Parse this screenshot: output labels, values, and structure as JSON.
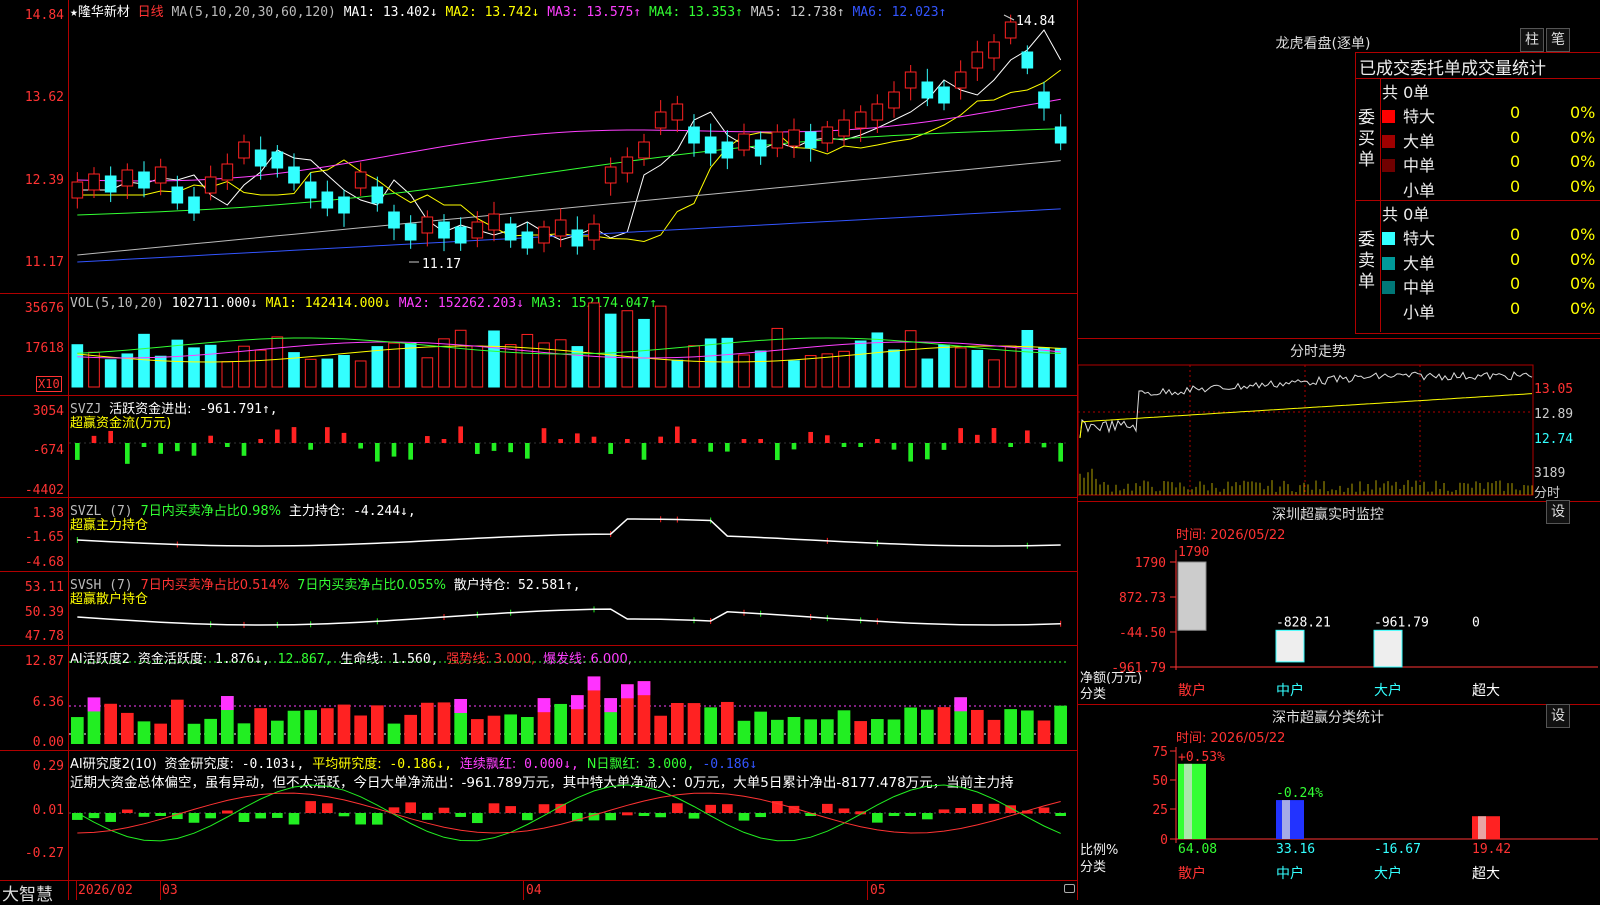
{
  "stock": {
    "name": "隆华新材",
    "period": "日线",
    "star": "★"
  },
  "ma_header": {
    "label": "MA(5,10,20,30,60,120)",
    "items": [
      {
        "text": "MA1: 13.402↓",
        "color": "#ffffff"
      },
      {
        "text": "MA2: 13.742↓",
        "color": "#ffff00"
      },
      {
        "text": "MA3: 13.575↑",
        "color": "#ff40ff"
      },
      {
        "text": "MA4: 13.353↑",
        "color": "#33ff33"
      },
      {
        "text": "MA5: 12.738↑",
        "color": "#cccccc"
      },
      {
        "text": "MA6: 12.023↑",
        "color": "#3355ff"
      }
    ]
  },
  "price_axis": {
    "ticks": [
      "14.84",
      "13.62",
      "12.39",
      "11.17"
    ],
    "high_label": "14.84",
    "low_label": "11.17"
  },
  "vol_header": {
    "label": "VOL(5,10,20)",
    "value": "102711.000↓",
    "items": [
      {
        "text": "MA1: 142414.000↓",
        "color": "#ffff00"
      },
      {
        "text": "MA2: 152262.203↓",
        "color": "#ff40ff"
      },
      {
        "text": "MA3: 152174.047↑",
        "color": "#33ff33"
      }
    ],
    "ticks": [
      "35676",
      "17618"
    ],
    "unit": "X10"
  },
  "svzj": {
    "label": "SVZJ",
    "title": "活跃资金进出:",
    "value": "-961.791↑,",
    "subtitle": "超赢资金流(万元)",
    "ticks": [
      "3054",
      "-674",
      "-4402"
    ]
  },
  "svzl": {
    "label": "SVZL (7)",
    "t1": "7日内买卖净占比0.98%",
    "t2": "主力持仓:",
    "v2": "-4.244↓,",
    "subtitle": "超赢主力持仓",
    "ticks": [
      "1.38",
      "-1.65",
      "-4.68"
    ]
  },
  "svsh": {
    "label": "SVSH (7)",
    "t1": "7日内买卖净占比0.514%",
    "t2": "7日内买卖净占比0.055%",
    "t3": "散户持仓:",
    "v3": "52.581↑,",
    "subtitle": "超赢散户持仓",
    "ticks": [
      "53.11",
      "50.39",
      "47.78"
    ]
  },
  "ai1": {
    "label": "AI活跃度2",
    "t1": "资金活跃度:",
    "v1": "1.876↓,",
    "v2": "12.867,",
    "t3": "生命线:",
    "v3": "1.560,",
    "t4": "强势线: 3.000,",
    "t5": "爆发线: 6.000,",
    "ticks": [
      "12.87",
      "6.36",
      "0.00"
    ]
  },
  "ai2": {
    "label": "AI研究度2(10)",
    "t1": "资金研究度:",
    "v1": "-0.103↓,",
    "t2": "平均研究度:",
    "v2": "-0.186↓,",
    "t3": "连续飘红:",
    "v3": "0.000↓,",
    "t4": "N日飘红:",
    "v4": "3.000,",
    "v5": "-0.186↓",
    "text": "近期大资金总体偏空，虽有异动，但不太活跃，今日大单净流出：-961.789万元，其中特大单净流入：0万元，大单5日累计净出-8177.478万元，当前主力持",
    "ticks": [
      "0.29",
      "0.01",
      "-0.27"
    ]
  },
  "time_axis": {
    "labels": [
      "2026/02",
      "03",
      "04",
      "05"
    ]
  },
  "brand": "大智慧",
  "right": {
    "title": "龙虎看盘(逐单)",
    "btn1": "柱",
    "btn2": "笔",
    "stats_title": "已成交委托单成交量统计",
    "buy_label": "委买单",
    "sell_label": "委卖单",
    "buy_total": "共 0单",
    "sell_total": "共 0单",
    "buy_rows": [
      {
        "name": "特大",
        "color": "#ff0000",
        "count": "0",
        "pct": "0%"
      },
      {
        "name": "大单",
        "color": "#a00000",
        "count": "0",
        "pct": "0%"
      },
      {
        "name": "中单",
        "color": "#700000",
        "count": "0",
        "pct": "0%"
      },
      {
        "name": "小单",
        "color": "",
        "count": "0",
        "pct": "0%"
      }
    ],
    "sell_rows": [
      {
        "name": "特大",
        "color": "#33ffff",
        "count": "0",
        "pct": "0%"
      },
      {
        "name": "大单",
        "color": "#009999",
        "count": "0",
        "pct": "0%"
      },
      {
        "name": "中单",
        "color": "#007777",
        "count": "0",
        "pct": "0%"
      },
      {
        "name": "小单",
        "color": "",
        "count": "0",
        "pct": "0%"
      }
    ],
    "intraday_title": "分时走势",
    "intraday_ticks": [
      "13.05",
      "12.89",
      "12.74"
    ],
    "intraday_vol": "3189",
    "intraday_vol_unit": "分时",
    "sz_title": "深圳超赢实时监控",
    "sz_btn": "设",
    "sz_time": "时间: 2026/05/22",
    "sz_ticks": [
      "1790",
      "872.73",
      "-44.50",
      "-961.79"
    ],
    "sz_axis_label": "净额(万元)",
    "sz_cat_label": "分类",
    "sz_bars": [
      {
        "cat": "散户",
        "value": "1790"
      },
      {
        "cat": "中户",
        "value": "-828.21"
      },
      {
        "cat": "大户",
        "value": "-961.79"
      },
      {
        "cat": "超大",
        "value": "0"
      }
    ],
    "cls_title": "深市超赢分类统计",
    "cls_btn": "设",
    "cls_time": "时间: 2026/05/22",
    "cls_ticks": [
      "75",
      "50",
      "25",
      "0"
    ],
    "cls_axis_label": "比例%",
    "cls_cat_label": "分类",
    "cls_bars": [
      {
        "cat": "散户",
        "top": "+0.53%",
        "bottom": "64.08"
      },
      {
        "cat": "中户",
        "top": "-0.24%",
        "bottom": "33.16"
      },
      {
        "cat": "大户",
        "top": "",
        "bottom": "-16.67"
      },
      {
        "cat": "超大",
        "top": "",
        "bottom": "19.42"
      }
    ]
  },
  "colors": {
    "up": "#ff2222",
    "down": "#33ffff",
    "grid": "#b00000"
  }
}
